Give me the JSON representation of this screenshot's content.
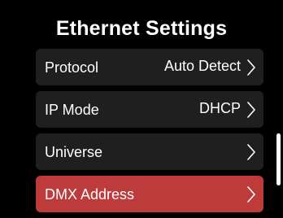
{
  "screen": {
    "title": "Ethernet Settings"
  },
  "menu": {
    "items": [
      {
        "label": "Protocol",
        "value": "Auto Detect",
        "selected": false
      },
      {
        "label": "IP Mode",
        "value": "DHCP",
        "selected": false
      },
      {
        "label": "Universe",
        "value": "",
        "selected": false
      },
      {
        "label": "DMX Address",
        "value": "",
        "selected": true
      }
    ]
  },
  "colors": {
    "background": "#000000",
    "item_bg": "#1f1f1f",
    "selected_bg": "#bd3b3a",
    "text": "#ffffff"
  },
  "icons": {
    "chevron": "chevron-right-icon"
  }
}
